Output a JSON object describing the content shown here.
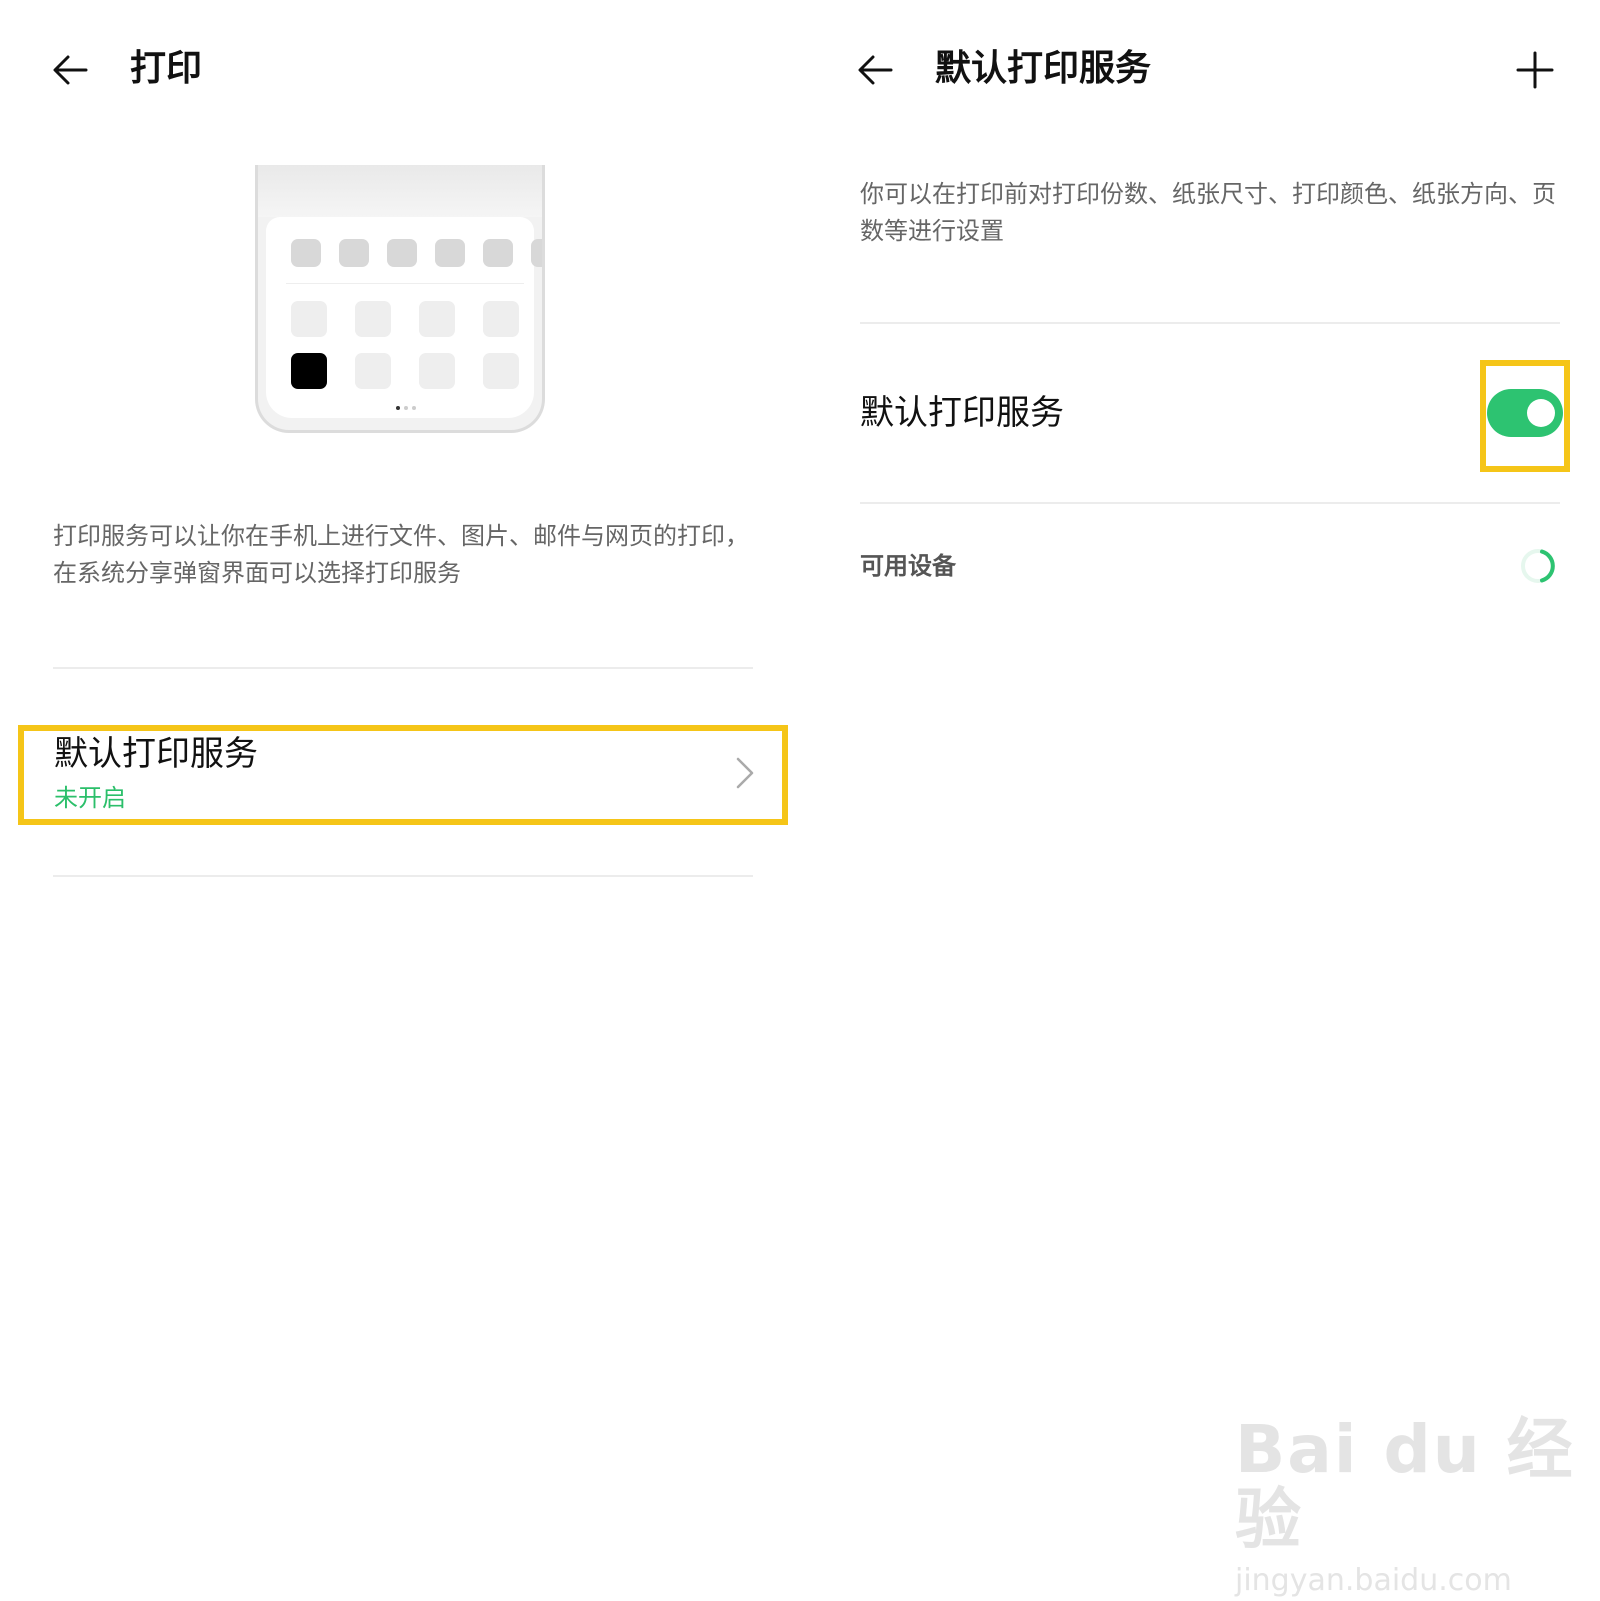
{
  "left": {
    "title": "打印",
    "description": "打印服务可以让你在手机上进行文件、图片、邮件与网页的打印，在系统分享弹窗界面可以选择打印服务",
    "service_item": {
      "title": "默认打印服务",
      "status": "未开启"
    }
  },
  "right": {
    "title": "默认打印服务",
    "description": "你可以在打印前对打印份数、纸张尺寸、打印颜色、纸张方向、页数等进行设置",
    "toggle_row": {
      "label": "默认打印服务",
      "state": "on"
    },
    "section_label": "可用设备"
  },
  "watermark": {
    "brand": "Bai du 经验",
    "url": "jingyan.baidu.com"
  },
  "icons": [
    "back-arrow-icon",
    "add-icon",
    "chevron-right-icon",
    "loading-spinner-icon"
  ],
  "colors": {
    "accent_green": "#2dc371",
    "highlight_yellow": "#f5c518",
    "status_green": "#2bbf6a"
  }
}
